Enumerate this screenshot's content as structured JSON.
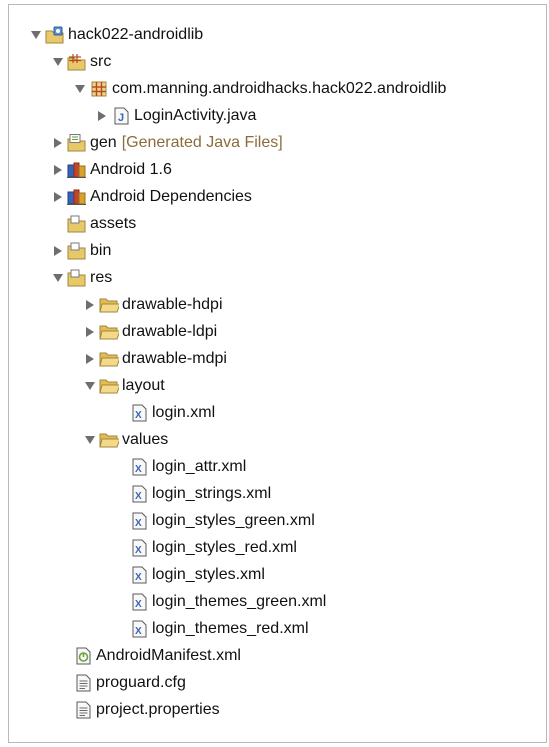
{
  "tree": {
    "project": "hack022-androidlib",
    "src": "src",
    "package": "com.manning.androidhacks.hack022.androidlib",
    "login_activity": "LoginActivity.java",
    "gen": "gen",
    "gen_decoration": "[Generated Java Files]",
    "android_lib": "Android 1.6",
    "android_deps": "Android Dependencies",
    "assets": "assets",
    "bin": "bin",
    "res": "res",
    "drawable_hdpi": "drawable-hdpi",
    "drawable_ldpi": "drawable-ldpi",
    "drawable_mdpi": "drawable-mdpi",
    "layout": "layout",
    "layout_files": [
      "login.xml"
    ],
    "values": "values",
    "values_files": [
      "login_attr.xml",
      "login_strings.xml",
      "login_styles_green.xml",
      "login_styles_red.xml",
      "login_styles.xml",
      "login_themes_green.xml",
      "login_themes_red.xml"
    ],
    "manifest": "AndroidManifest.xml",
    "proguard": "proguard.cfg",
    "project_properties": "project.properties"
  }
}
